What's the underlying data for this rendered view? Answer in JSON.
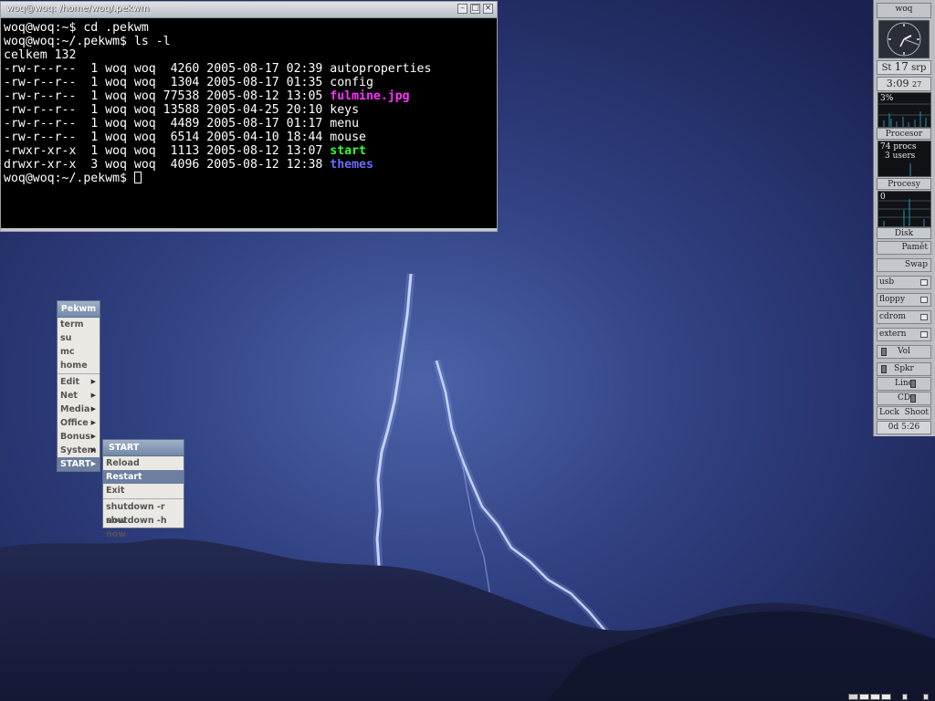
{
  "terminal": {
    "title": "woq@woq: /home/woq/.pekwm",
    "lines": [
      {
        "text": "woq@woq:~$ cd .pekwm"
      },
      {
        "text": "woq@woq:~/.pekwm$ ls -l"
      },
      {
        "text": "celkem 132"
      },
      {
        "perm": "-rw-r--r--",
        "links": "1",
        "user": "woq",
        "group": "woq",
        "size": "4260",
        "date": "2005-08-17 02:39",
        "name": "autoproperties",
        "color": "#ffffff"
      },
      {
        "perm": "-rw-r--r--",
        "links": "1",
        "user": "woq",
        "group": "woq",
        "size": "1304",
        "date": "2005-08-17 01:35",
        "name": "config",
        "color": "#ffffff"
      },
      {
        "perm": "-rw-r--r--",
        "links": "1",
        "user": "woq",
        "group": "woq",
        "size": "77538",
        "date": "2005-08-12 13:05",
        "name": "fulmine.jpg",
        "color": "#ff33ff"
      },
      {
        "perm": "-rw-r--r--",
        "links": "1",
        "user": "woq",
        "group": "woq",
        "size": "13588",
        "date": "2005-04-25 20:10",
        "name": "keys",
        "color": "#ffffff"
      },
      {
        "perm": "-rw-r--r--",
        "links": "1",
        "user": "woq",
        "group": "woq",
        "size": "4489",
        "date": "2005-08-17 01:17",
        "name": "menu",
        "color": "#ffffff"
      },
      {
        "perm": "-rw-r--r--",
        "links": "1",
        "user": "woq",
        "group": "woq",
        "size": "6514",
        "date": "2005-04-10 18:44",
        "name": "mouse",
        "color": "#ffffff"
      },
      {
        "perm": "-rwxr-xr-x",
        "links": "1",
        "user": "woq",
        "group": "woq",
        "size": "1113",
        "date": "2005-08-12 13:07",
        "name": "start",
        "color": "#33ff33"
      },
      {
        "perm": "drwxr-xr-x",
        "links": "3",
        "user": "woq",
        "group": "woq",
        "size": "4096",
        "date": "2005-08-12 12:38",
        "name": "themes",
        "color": "#6a6aff"
      }
    ],
    "prompt": "woq@woq:~/.pekwm$ "
  },
  "root_menu": {
    "title": "Pekwm",
    "items": [
      {
        "label": "term",
        "submenu": false
      },
      {
        "label": "su",
        "submenu": false
      },
      {
        "label": "mc",
        "submenu": false
      },
      {
        "label": "home",
        "submenu": false
      },
      {
        "sep": true
      },
      {
        "label": "Edit",
        "submenu": true
      },
      {
        "label": "Net",
        "submenu": true
      },
      {
        "label": "Media",
        "submenu": true
      },
      {
        "label": "Office",
        "submenu": true
      },
      {
        "label": "Bonus",
        "submenu": true
      },
      {
        "label": "System",
        "submenu": true
      },
      {
        "label": "START",
        "submenu": true,
        "active": true
      }
    ]
  },
  "start_menu": {
    "title": "START",
    "items": [
      {
        "label": "Reload"
      },
      {
        "label": "Restart",
        "active": true
      },
      {
        "label": "Exit"
      },
      {
        "sep": true
      },
      {
        "label": "shutdown -r now"
      },
      {
        "label": "shutdown -h now"
      }
    ]
  },
  "gkrellm": {
    "hostname": "woq",
    "date_day": "St",
    "date_num": "17",
    "date_month": "srp",
    "time": "3:09",
    "seconds": "27",
    "cpu_percent": "3%",
    "cpu_label": "Procesor",
    "procs": "74 procs",
    "users": "3 users",
    "proc_label": "Procesy",
    "disk_value": "0",
    "disk_label": "Disk",
    "mem_label": "Pamět",
    "swap_label": "Swap",
    "mounts": [
      "usb",
      "floppy",
      "cdrom",
      "extern"
    ],
    "vol_label": "Vol",
    "spkr_label": "Spkr",
    "line_label": "Line",
    "cd_label": "CD",
    "lock_label": "Lock",
    "shoot_label": "Shoot",
    "uptime": "0d 5:26"
  },
  "colors": {
    "sky_top": "#1d2348",
    "sky_mid": "#3a4f8e",
    "hill": "#1a1f3e",
    "lightning": "#c9d8ff",
    "menu_bg": "#e9e8e3",
    "menu_active": "#6d7fa1"
  }
}
